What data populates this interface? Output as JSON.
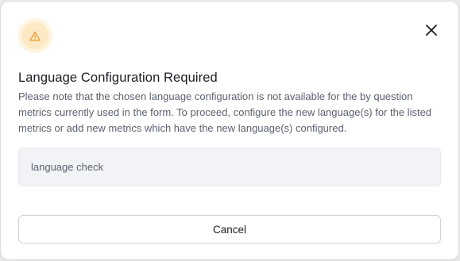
{
  "dialog": {
    "icon": "warning-icon",
    "close_icon": "close-icon",
    "title": "Language Configuration Required",
    "description": "Please note that the chosen language configuration is not available for the by question metrics currently used in the form. To proceed, configure the new language(s) for the listed metrics or add new metrics which have the new language(s) configured.",
    "check_item": "language check",
    "cancel_label": "Cancel"
  },
  "colors": {
    "warning_accent": "#e8a23a",
    "warning_bg": "#fde9c4",
    "text_primary": "#1a1d24",
    "text_secondary": "#5b6170"
  }
}
